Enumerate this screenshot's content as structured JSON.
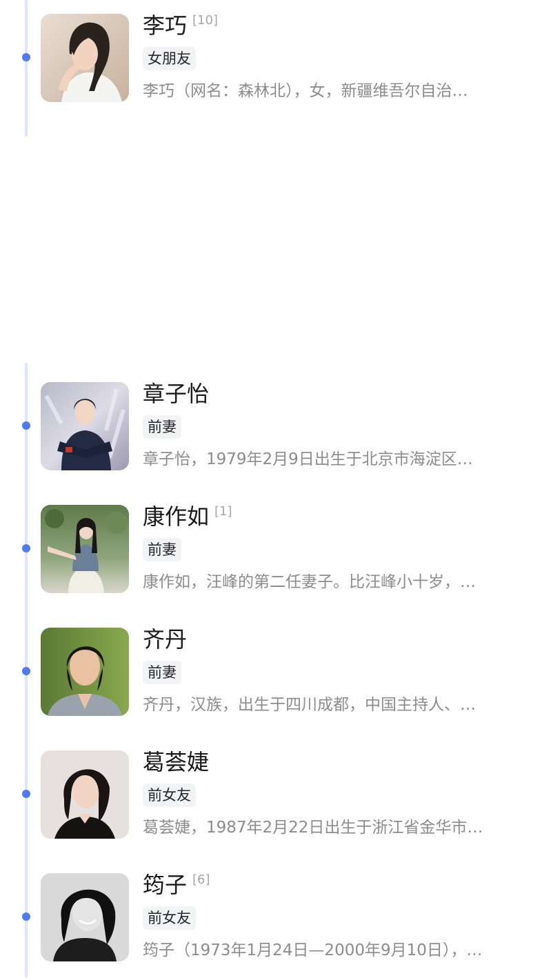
{
  "colors": {
    "accent": "#4e7bf0",
    "timeline": "#dde4fb",
    "tag_bg": "#f2f3f5",
    "desc_text": "#8c8c8c"
  },
  "entries": [
    {
      "name": "李巧",
      "ref": "[10]",
      "tag": "女朋友",
      "desc": "李巧（网名：森林北），女，新疆维吾尔自治…"
    },
    {
      "name": "章子怡",
      "ref": "",
      "tag": "前妻",
      "desc": "章子怡，1979年2月9日出生于北京市海淀区…"
    },
    {
      "name": "康作如",
      "ref": "[1]",
      "tag": "前妻",
      "desc": "康作如，汪峰的第二任妻子。比汪峰小十岁，…"
    },
    {
      "name": "齐丹",
      "ref": "",
      "tag": "前妻",
      "desc": "齐丹，汉族，出生于四川成都，中国主持人、…"
    },
    {
      "name": "葛荟婕",
      "ref": "",
      "tag": "前女友",
      "desc": "葛荟婕，1987年2月22日出生于浙江省金华市…"
    },
    {
      "name": "筠子",
      "ref": "[6]",
      "tag": "前女友",
      "desc": "筠子（1973年1月24日—2000年9月10日），…"
    }
  ]
}
